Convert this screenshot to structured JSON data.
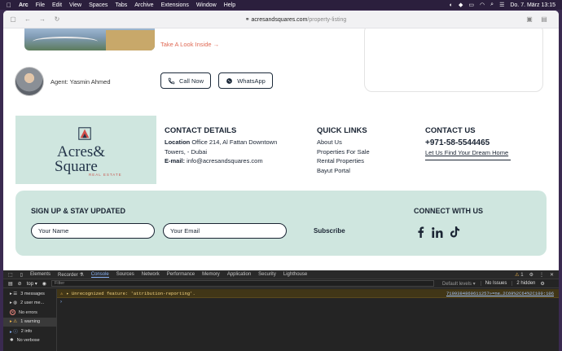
{
  "menubar": {
    "items": [
      "Arc",
      "File",
      "Edit",
      "View",
      "Spaces",
      "Tabs",
      "Archive",
      "Extensions",
      "Window",
      "Help"
    ],
    "datetime": "Do. 7. März  13:15"
  },
  "browser": {
    "url_host": "acresandsquares.com",
    "url_path": "/property-listing"
  },
  "listing": {
    "take_look": "Take A Look Inside",
    "agent": "Agent: Yasmin Ahmed",
    "call_label": "Call Now",
    "whatsapp_label": "WhatsApp"
  },
  "logo": {
    "line1": "Acres&",
    "line2": "Square",
    "sub": "REAL ESTATE"
  },
  "contact": {
    "heading": "CONTACT DETAILS",
    "location_label": "Location",
    "location_value": "Office 214, Al Fattan Downtown Towers, - Dubai",
    "email_label": "E-mail:",
    "email_value": "info@acresandsquares.com"
  },
  "quick_links": {
    "heading": "QUICK LINKS",
    "items": [
      "About Us",
      "Properties For Sale",
      "Rental Properties",
      "Bayut Portal"
    ]
  },
  "contact_us": {
    "heading": "CONTACT US",
    "phone": "+971-58-5544465",
    "tagline": "Let Us Find Your Dream Home"
  },
  "signup": {
    "heading": "SIGN UP & STAY UPDATED",
    "name_placeholder": "Your Name",
    "email_placeholder": "Your Email",
    "subscribe": "Subscribe",
    "connect": "CONNECT WITH US"
  },
  "devtools": {
    "tabs": [
      "Elements",
      "Recorder ⚗",
      "Console",
      "Sources",
      "Network",
      "Performance",
      "Memory",
      "Application",
      "Security",
      "Lighthouse"
    ],
    "active_tab": "Console",
    "warning_count": "1",
    "context": "top",
    "filter_placeholder": "Filter",
    "levels": "Default levels ▾",
    "issues": "No Issues",
    "hidden": "2 hidden",
    "sidebar": [
      {
        "label": "3 messages",
        "icon": "list-icon"
      },
      {
        "label": "2 user me...",
        "icon": "user-icon"
      },
      {
        "label": "No errors",
        "icon": "error-icon"
      },
      {
        "label": "1 warning",
        "icon": "warning-icon"
      },
      {
        "label": "2 info",
        "icon": "info-icon"
      },
      {
        "label": "No verbose",
        "icon": "bug-icon"
      }
    ],
    "warning_text": "▸ Unrecognized feature: 'attribution-reporting'.",
    "warning_source": "7199384869611257»=ne…2C69%2C64%2C100:106"
  }
}
